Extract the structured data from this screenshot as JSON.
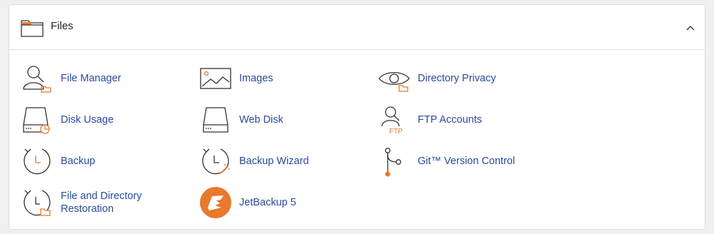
{
  "section": {
    "title": "Files",
    "icon": "folder-icon",
    "toggle_icon": "chevron-up-icon"
  },
  "colors": {
    "link": "#2b4a9e",
    "accent": "#e8792d",
    "icon_stroke": "#333333"
  },
  "items": [
    {
      "label": "File Manager",
      "icon": "file-manager-icon"
    },
    {
      "label": "Images",
      "icon": "images-icon"
    },
    {
      "label": "Directory Privacy",
      "icon": "directory-privacy-icon"
    },
    {
      "label": "Disk Usage",
      "icon": "disk-usage-icon"
    },
    {
      "label": "Web Disk",
      "icon": "web-disk-icon"
    },
    {
      "label": "FTP Accounts",
      "icon": "ftp-accounts-icon",
      "icon_text": "FTP"
    },
    {
      "label": "Backup",
      "icon": "backup-icon"
    },
    {
      "label": "Backup Wizard",
      "icon": "backup-wizard-icon"
    },
    {
      "label": "Git™ Version Control",
      "icon": "git-icon"
    },
    {
      "label": "File and Directory Restoration",
      "icon": "restoration-icon"
    },
    {
      "label": "JetBackup 5",
      "icon": "jetbackup-icon"
    }
  ]
}
